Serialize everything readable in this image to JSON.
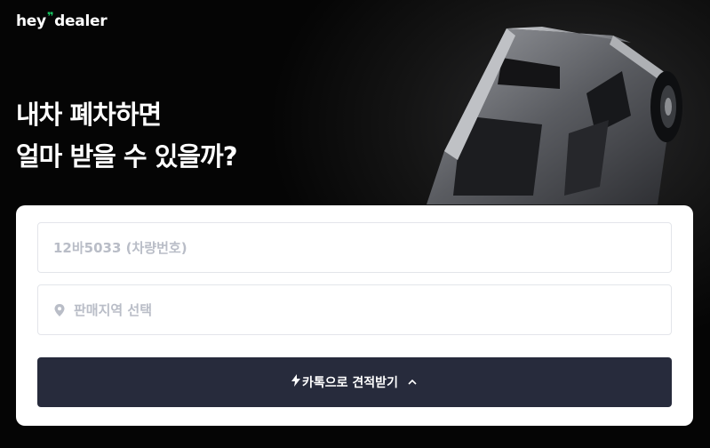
{
  "brand": {
    "logo_left": "hey",
    "logo_mark": "❞",
    "logo_right": "dealer",
    "accent": "#17c964"
  },
  "hero": {
    "line1": "내차 폐차하면",
    "line2": "얼마 받을 수 있을까?"
  },
  "form": {
    "plate_placeholder": "12바5033 (차량번호)",
    "region_placeholder": "판매지역 선택",
    "submit_label": "카톡으로 견적받기",
    "button_color": "#272b3c"
  },
  "icons": {
    "region": "location-pin-icon",
    "bolt": "lightning-icon",
    "chevron": "chevron-up-icon"
  }
}
